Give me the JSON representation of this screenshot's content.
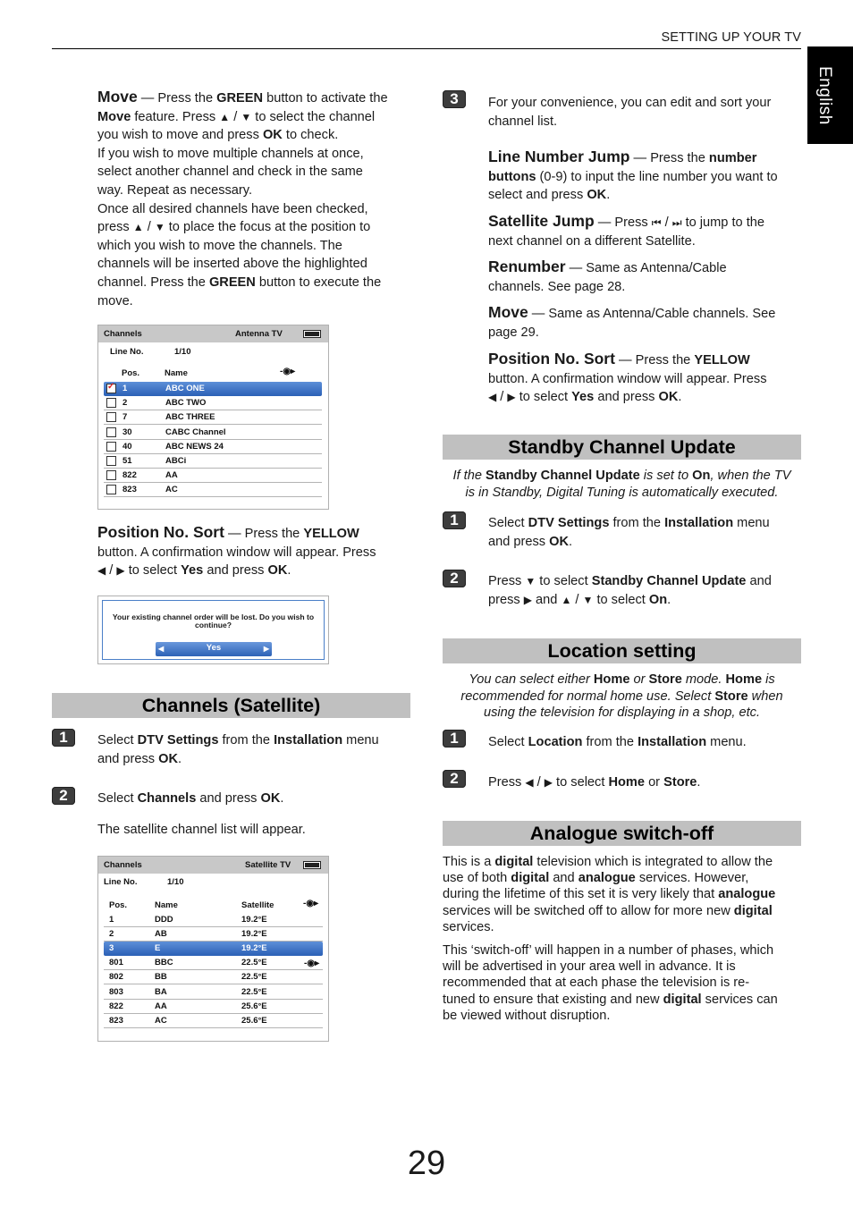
{
  "header": {
    "section_title": "SETTING UP YOUR TV",
    "language_tab": "English"
  },
  "left": {
    "move": {
      "title": "Move",
      "dash": " — Press the ",
      "green": "GREEN",
      "t1": " button to activate the",
      "move2": "Move",
      "t2": " feature. Press ",
      "up": "▲",
      "slash": " / ",
      "down": "▼",
      "t3": " to select the channel",
      "t4": "you wish to move and press ",
      "ok": "OK",
      "t5": " to check.",
      "l4": "If you wish to move multiple channels at once,",
      "l5": "select another channel and check in the same",
      "l6": "way. Repeat as necessary.",
      "l7": "Once all desired channels have been checked,",
      "l8a": "press ",
      "l8b": " to place the focus at the position to",
      "l9": "which you wish to move the channels. The",
      "l10": "channels will be inserted above the highlighted",
      "l11a": "channel. Press the ",
      "l11b": " button to execute the",
      "l12": "move."
    },
    "antenna_screen": {
      "title": "Channels",
      "source": "Antenna TV",
      "line_label": "Line No.",
      "line_value": "1/10",
      "col_pos": "Pos.",
      "col_name": "Name",
      "rows": [
        {
          "pos": "1",
          "name": "ABC ONE",
          "checked": true,
          "selected": true
        },
        {
          "pos": "2",
          "name": "ABC TWO",
          "checked": false,
          "selected": false
        },
        {
          "pos": "7",
          "name": "ABC THREE",
          "checked": false,
          "selected": false
        },
        {
          "pos": "30",
          "name": "CABC Channel",
          "checked": false,
          "selected": false
        },
        {
          "pos": "40",
          "name": "ABC NEWS 24",
          "checked": false,
          "selected": false
        },
        {
          "pos": "51",
          "name": "ABCi",
          "checked": false,
          "selected": false
        },
        {
          "pos": "822",
          "name": "AA",
          "checked": false,
          "selected": false
        },
        {
          "pos": "823",
          "name": "AC",
          "checked": false,
          "selected": false
        }
      ]
    },
    "pos_sort": {
      "title": "Position No. Sort",
      "t1": " — Press the ",
      "yellow": "YELLOW",
      "l2": "button. A confirmation window will appear. Press",
      "left": "◀",
      "slash": " / ",
      "right": "▶",
      "t3": " to select ",
      "yes": "Yes",
      "t4": " and press ",
      "ok": "OK",
      "dot": "."
    },
    "dialog": {
      "message": "Your existing channel order will be lost. Do you wish to continue?",
      "option": "Yes",
      "left_arrow": "◀",
      "right_arrow": "▶"
    },
    "sat_section": {
      "title": "Channels (Satellite)",
      "step1_num": "1",
      "step1_a": "Select ",
      "step1_b": "DTV Settings",
      "step1_c": " from the ",
      "step1_d": "Installation",
      "step1_e": " menu",
      "step1_f": "and press ",
      "step1_g": "OK",
      "step1_h": ".",
      "step2_num": "2",
      "step2_a": "Select ",
      "step2_b": "Channels",
      "step2_c": " and press ",
      "step2_d": "OK",
      "step2_e": ".",
      "step2_note": "The satellite channel list will appear."
    },
    "sat_screen": {
      "title": "Channels",
      "source": "Satellite TV",
      "line_label": "Line No.",
      "line_value": "1/10",
      "col_pos": "Pos.",
      "col_name": "Name",
      "col_sat": "Satellite",
      "rows": [
        {
          "pos": "1",
          "name": "DDD",
          "sat": "19.2°E",
          "selected": false
        },
        {
          "pos": "2",
          "name": "AB",
          "sat": "19.2°E",
          "selected": false
        },
        {
          "pos": "3",
          "name": "E",
          "sat": "19.2°E",
          "selected": true
        },
        {
          "pos": "801",
          "name": "BBC",
          "sat": "22.5°E",
          "selected": false
        },
        {
          "pos": "802",
          "name": "BB",
          "sat": "22.5°E",
          "selected": false
        },
        {
          "pos": "803",
          "name": "BA",
          "sat": "22.5°E",
          "selected": false
        },
        {
          "pos": "822",
          "name": "AA",
          "sat": "25.6°E",
          "selected": false
        },
        {
          "pos": "823",
          "name": "AC",
          "sat": "25.6°E",
          "selected": false
        }
      ]
    }
  },
  "right": {
    "step3": {
      "num": "3",
      "text1": "For your convenience, you can edit and sort your",
      "text2": "channel list."
    },
    "line_jump": {
      "title": "Line Number Jump",
      "t1": " — Press the ",
      "b1": "number",
      "b2": "buttons",
      "t2": " (0-9) to input the line number you want to",
      "t3": "select and press ",
      "ok": "OK",
      "dot": "."
    },
    "sat_jump": {
      "title": "Satellite Jump",
      "t1": " — Press ",
      "prev": "⏮",
      "slash": " / ",
      "next": "⏭",
      "t2": " to jump to the",
      "t3": "next channel on a different Satellite."
    },
    "renumber": {
      "title": "Renumber",
      "t1": " — Same as Antenna/Cable",
      "t2": "channels. See page 28."
    },
    "move": {
      "title": "Move",
      "t1": " — Same as Antenna/Cable channels. See",
      "t2": "page 29."
    },
    "pos_sort": {
      "title": "Position No. Sort",
      "t1": " — Press the ",
      "yellow": "YELLOW",
      "l2": "button. A confirmation window will appear. Press",
      "left": "◀",
      "slash": " / ",
      "right": "▶",
      "t3": " to select ",
      "yes": "Yes",
      "t4": " and press ",
      "ok": "OK",
      "dot": "."
    },
    "standby": {
      "title": "Standby Channel Update",
      "i1": "If the ",
      "b1": "Standby Channel Update",
      "i2": " is set to ",
      "b2": "On",
      "i3": ", when the TV",
      "i4": "is in Standby, Digital Tuning is automatically executed.",
      "step1_num": "1",
      "s1a": "Select ",
      "s1b": "DTV Settings",
      "s1c": " from the ",
      "s1d": "Installation",
      "s1e": " menu",
      "s1f": "and press ",
      "s1g": "OK",
      "s1h": ".",
      "step2_num": "2",
      "s2a": "Press ",
      "down": "▼",
      "s2b": " to select ",
      "s2c": "Standby Channel Update",
      "s2d": " and",
      "s2e": "press ",
      "right": "▶",
      "s2f": " and ",
      "up": "▲",
      "slash": " / ",
      "s2g": " to select ",
      "s2h": "On",
      "s2i": "."
    },
    "location": {
      "title": "Location setting",
      "i1": "You can select either ",
      "b1": "Home",
      "i2": " or ",
      "b2": "Store",
      "i3": " mode. ",
      "b3": "Home",
      "i4": " is",
      "i5": "recommended for normal home use. Select ",
      "b4": "Store",
      "i6": " when",
      "i7": "using the television for displaying in a shop, etc.",
      "step1_num": "1",
      "s1a": "Select ",
      "s1b": "Location",
      "s1c": " from the ",
      "s1d": "Installation",
      "s1e": " menu.",
      "step2_num": "2",
      "s2a": "Press ",
      "left": "◀",
      "slash": " / ",
      "right": "▶",
      "s2b": " to select ",
      "s2c": "Home",
      "s2d": " or ",
      "s2e": "Store",
      "s2f": "."
    },
    "analogue": {
      "title": "Analogue switch-off",
      "p1_l1a": "This is a ",
      "digital": "digital",
      "p1_l1b": " television which is integrated to allow the",
      "p1_l2a": "use of both ",
      "p1_l2b": " and ",
      "analogue": "analogue",
      "p1_l2c": " services. However,",
      "p1_l3a": "during the lifetime of this set it is very likely that ",
      "p1_l4a": "services will be switched off to allow for more new ",
      "p1_l5": "services.",
      "p2_l1": "This ‘switch-off’ will happen in a number of phases, which",
      "p2_l2": "will be advertised in your area well in advance. It is",
      "p2_l3": "recommended that at each phase the television is re-",
      "p2_l4a": "tuned to ensure that existing and new ",
      "p2_l4b": " services can",
      "p2_l5": "be viewed without disruption."
    }
  },
  "page_number": "29"
}
